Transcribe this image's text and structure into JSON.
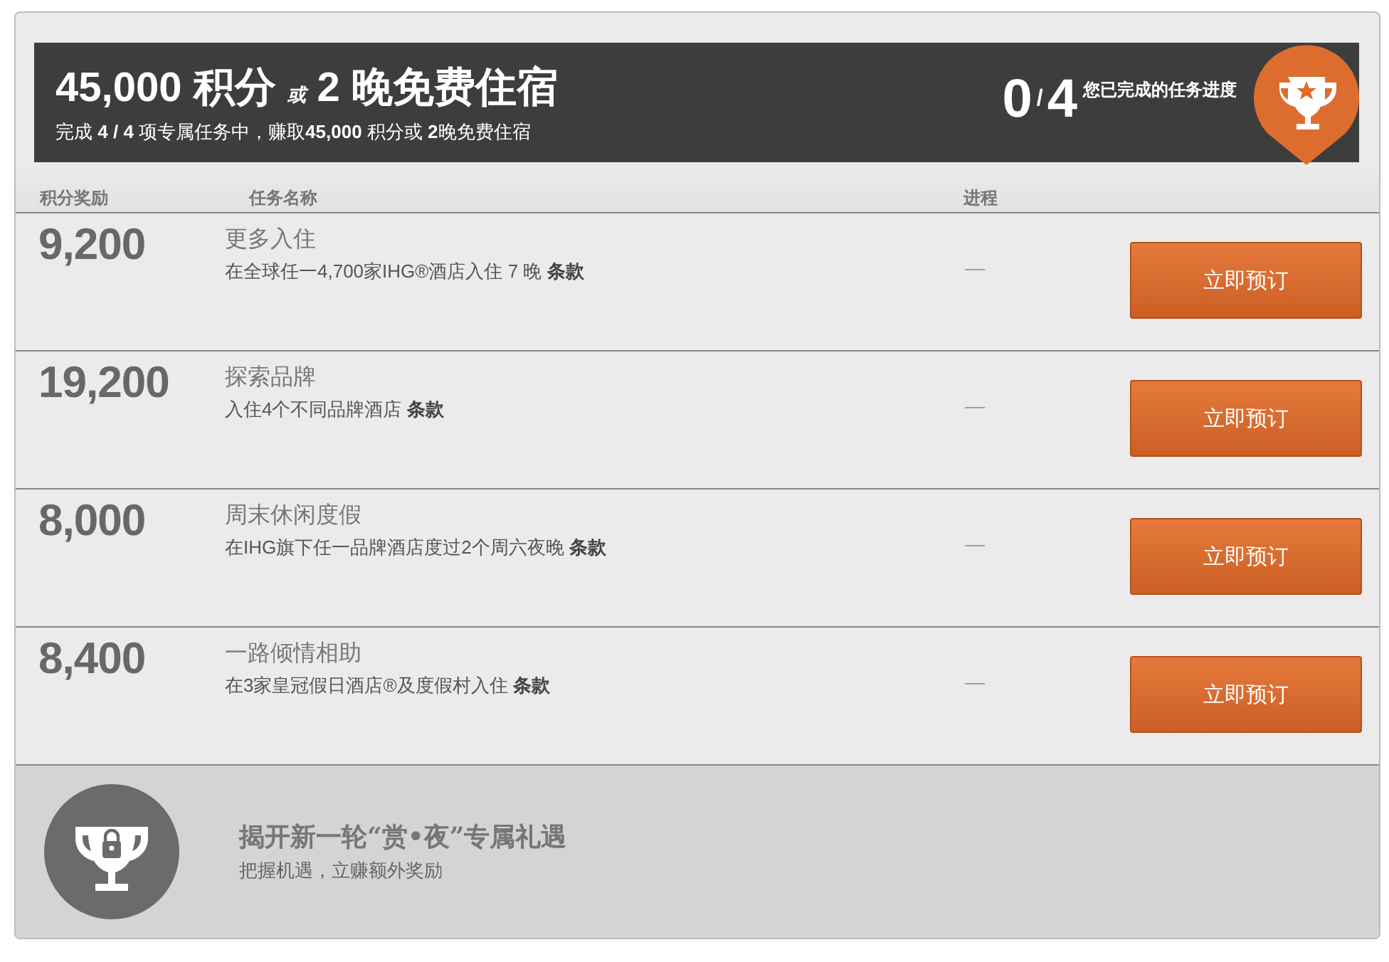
{
  "header": {
    "title_points": "45,000 积分",
    "title_or": "或",
    "title_nights": "2 晚免费住宿",
    "subtitle": "完成 **4 / 4** 项专属任务中，赚取**45,000** 积分或 **2**晚免费住宿",
    "progress_done": "0",
    "progress_sep": "/",
    "progress_total": "4",
    "progress_label": "您已完成的任务进度"
  },
  "columns": [
    "积分奖励",
    "任务名称",
    "进程"
  ],
  "tasks": [
    {
      "points": "9,200",
      "name": "更多入住",
      "description": "在全球任一4,700家IHG®酒店入住 7 晚",
      "terms": "条款",
      "progress": "—",
      "button": "立即预订"
    },
    {
      "points": "19,200",
      "name": "探索品牌",
      "description": "入住4个不同品牌酒店",
      "terms": "条款",
      "progress": "—",
      "button": "立即预订"
    },
    {
      "points": "8,000",
      "name": "周末休闲度假",
      "description": "在IHG旗下任一品牌酒店度过2个周六夜晚",
      "terms": "条款",
      "progress": "—",
      "button": "立即预订"
    },
    {
      "points": "8,400",
      "name": "一路倾情相助",
      "description": "在3家皇冠假日酒店®及度假村入住",
      "terms": "条款",
      "progress": "—",
      "button": "立即预订"
    }
  ],
  "footer": {
    "title": "揭开新一轮“赏•夜”专属礼遇",
    "subtitle": "把握机遇，立赚额外奖励"
  }
}
